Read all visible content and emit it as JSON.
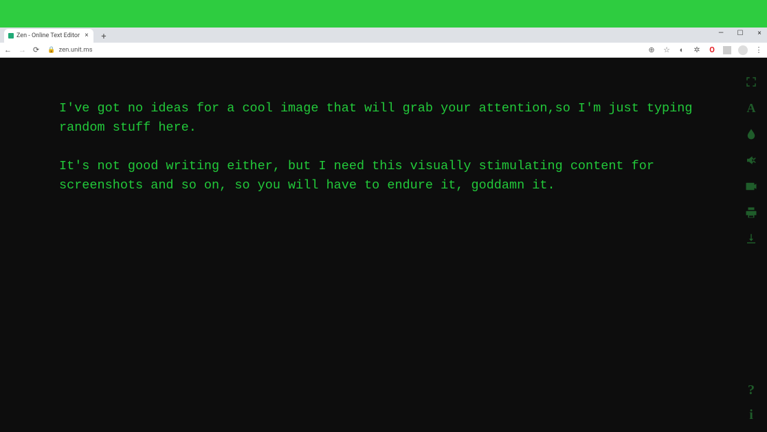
{
  "tab": {
    "title": "Zen - Online Text Editor"
  },
  "address": {
    "url": "zen.unit.ms"
  },
  "editor": {
    "paragraph1": "I've got no ideas for a cool image that will grab your attention,so I'm just typing random stuff here.",
    "paragraph2": "It's not good writing either, but I need this visually stimulating content for screenshots and so on, so you will have to endure it, goddamn it."
  },
  "tools": {
    "fullscreen": "fullscreen-icon",
    "font": "A",
    "theme": "theme-icon",
    "sound": "sound-icon",
    "video": "video-icon",
    "print": "print-icon",
    "download": "download-icon",
    "help": "?",
    "info": "i"
  }
}
